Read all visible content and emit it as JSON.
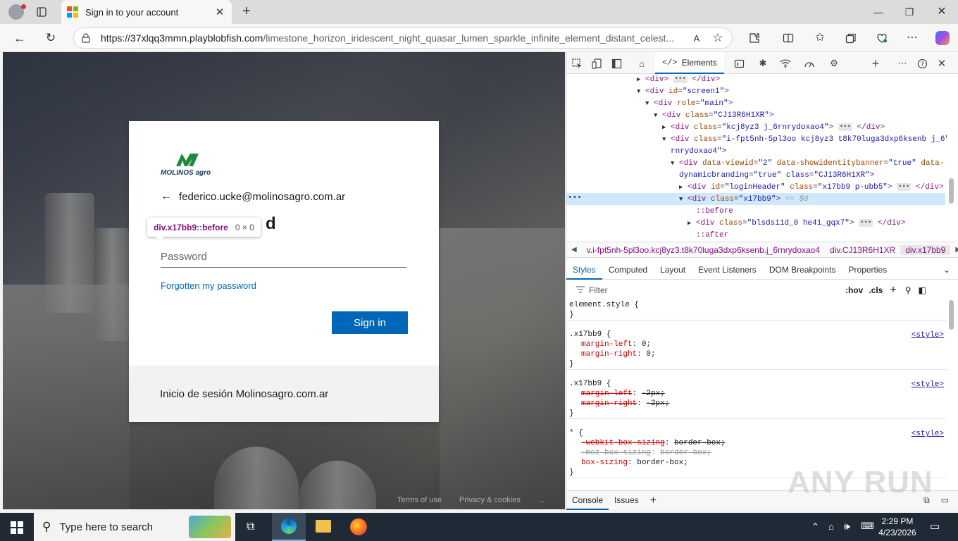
{
  "browser": {
    "tab": {
      "title": "Sign in to your account"
    },
    "address": {
      "url_host": "https://37xlqq3mmn.playblobfish.com",
      "url_path": "/limestone_horizon_iridescent_night_quasar_lumen_sparkle_infinite_element_distant_celest..."
    }
  },
  "colors": {
    "brand_blue": "#0067b8",
    "logo_green": "#1e8a3c",
    "taskbar": "#1f2a36",
    "devtools_accent": "#0067b8"
  },
  "signin": {
    "logo_text": "MOLINOS agro",
    "identity_email": "federico.ucke@molinosagro.com.ar",
    "heading_visible": "d",
    "password_placeholder": "Password",
    "forgot_label": "Forgotten my password",
    "signin_label": "Sign in",
    "footer_text": "Inicio de sesión Molinosagro.com.ar"
  },
  "tooltip": {
    "selector": "div.x17bb9::before",
    "size": "0 × 0"
  },
  "page_footer": {
    "terms": "Terms of use",
    "privacy": "Privacy & cookies",
    "more": "..."
  },
  "devtools": {
    "elements_tab": "Elements",
    "dom_lines": [
      {
        "indent": 0,
        "tri": "▶",
        "html": "div_collapsed"
      },
      {
        "indent": 0,
        "tri": "▼",
        "tag": "div",
        "attrs": [
          [
            "id",
            "screen1"
          ]
        ]
      },
      {
        "indent": 1,
        "tri": "▼",
        "tag": "div",
        "attrs": [
          [
            "role",
            "main"
          ]
        ]
      },
      {
        "indent": 2,
        "tri": "▼",
        "tag": "div",
        "attrs": [
          [
            "class",
            "CJ13R6H1XR"
          ]
        ]
      },
      {
        "indent": 3,
        "tri": "▶",
        "tag": "div",
        "attrs": [
          [
            "class",
            "kcj8yz3 j_6rnrydoxao4"
          ]
        ],
        "collapsed": true
      },
      {
        "indent": 3,
        "tri": "▼",
        "tag": "div",
        "attrs": [
          [
            "class",
            "i-fpt5nh-5pl3oo kcj8yz3 t8k70luga3dxp6ksenb j_6"
          ]
        ]
      },
      {
        "indent": 3,
        "cont": "rnrydoxao4\">"
      },
      {
        "indent": 4,
        "tri": "▼",
        "tag": "div",
        "attrs": [
          [
            "data-viewid",
            "2"
          ],
          [
            "data-showidentitybanner",
            "true"
          ],
          [
            "data-",
            ""
          ]
        ],
        "raw": true
      },
      {
        "indent": 4,
        "cont": "dynamicbranding=\"true\" class=\"CJ13R6H1XR\">"
      },
      {
        "indent": 5,
        "tri": "▶",
        "tag": "div",
        "attrs": [
          [
            "id",
            "loginHeader"
          ],
          [
            "class",
            "x17bb9 p-ubb5"
          ]
        ],
        "collapsed": true
      },
      {
        "indent": 5,
        "tri": "▼",
        "tag": "div",
        "attrs": [
          [
            "class",
            "x17bb9"
          ]
        ],
        "selected": true
      },
      {
        "indent": 6,
        "pseudo": "::before"
      },
      {
        "indent": 6,
        "tri": "▶",
        "tag": "div",
        "attrs": [
          [
            "class",
            "blsds11d_0 he41_gqx7"
          ]
        ],
        "collapsed": true
      },
      {
        "indent": 6,
        "pseudo": "::after"
      }
    ],
    "selected_suffix": "== $0",
    "breadcrumb": [
      "v.i-fpt5nh-5pl3oo.kcj8yz3.t8k70luga3dxp6ksenb.j_6rnrydoxao4",
      "div.CJ13R6H1XR",
      "div.x17bb9"
    ],
    "subtabs": [
      "Styles",
      "Computed",
      "Layout",
      "Event Listeners",
      "DOM Breakpoints",
      "Properties"
    ],
    "filter_placeholder": "Filter",
    "hov": ":hov",
    "cls": ".cls",
    "rules": [
      {
        "selector": "element.style {",
        "props": [],
        "source": ""
      },
      {
        "selector": ".x17bb9 {",
        "source": "<style>",
        "props": [
          {
            "name": "margin-left",
            "value": "0;",
            "struck": false
          },
          {
            "name": "margin-right",
            "value": "0;",
            "struck": false
          }
        ]
      },
      {
        "selector": ".x17bb9 {",
        "source": "<style>",
        "props": [
          {
            "name": "margin-left",
            "value": "-2px;",
            "struck": true
          },
          {
            "name": "margin-right",
            "value": "-2px;",
            "struck": true
          }
        ]
      },
      {
        "selector": "* {",
        "source": "<style>",
        "props": [
          {
            "name": "-webkit-box-sizing",
            "value": "border-box;",
            "struck": true
          },
          {
            "name": "-moz-box-sizing",
            "value": "border-box;",
            "struck": true,
            "dim": true
          },
          {
            "name": "box-sizing",
            "value": "border-box;",
            "struck": false
          }
        ]
      }
    ],
    "console_tabs": [
      "Console",
      "Issues"
    ]
  },
  "watermark": "ANY RUN",
  "taskbar": {
    "search_placeholder": "Type here to search",
    "time": "2:29 PM",
    "date": "4/23/2026"
  }
}
